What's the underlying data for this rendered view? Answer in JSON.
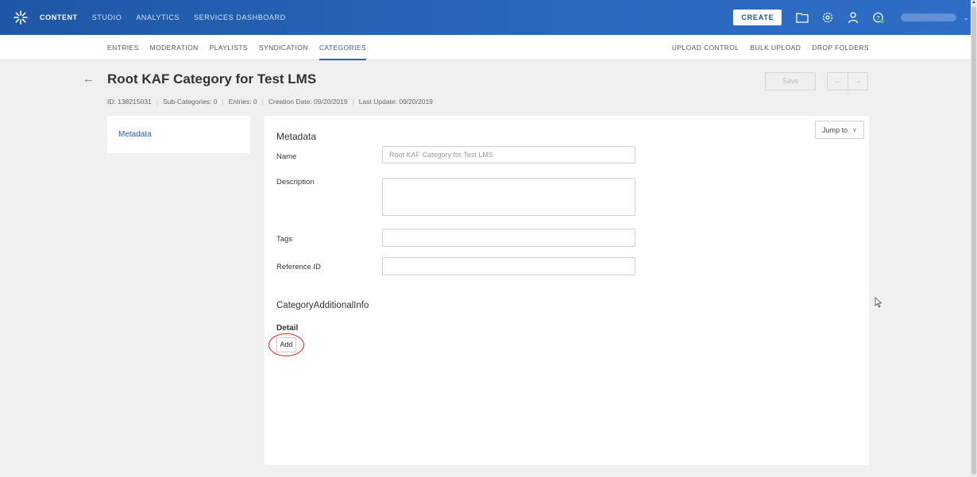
{
  "topnav": {
    "items": [
      "CONTENT",
      "STUDIO",
      "ANALYTICS",
      "SERVICES DASHBOARD"
    ],
    "create_label": "CREATE"
  },
  "subnav": {
    "left": [
      "ENTRIES",
      "MODERATION",
      "PLAYLISTS",
      "SYNDICATION",
      "CATEGORIES"
    ],
    "right": [
      "UPLOAD CONTROL",
      "BULK UPLOAD",
      "DROP FOLDERS"
    ],
    "active": "CATEGORIES"
  },
  "header": {
    "back_icon": "arrow-left-icon",
    "title": "Root KAF Category for Test LMS",
    "meta": {
      "id": "ID: 138215031",
      "subcategories": "Sub-Categories: 0",
      "entries": "Entries: 0",
      "created": "Creation Date: 09/20/2019",
      "updated": "Last Update: 09/20/2019"
    },
    "save_label": "Save",
    "prev_icon": "←",
    "next_icon": "→"
  },
  "sidebar": {
    "items": [
      {
        "label": "Metadata"
      }
    ]
  },
  "main": {
    "jump_label": "Jump to",
    "section_title": "Metadata",
    "fields": {
      "name": {
        "label": "Name",
        "value": "Root KAF Category for Test LMS"
      },
      "description": {
        "label": "Description",
        "value": ""
      },
      "tags": {
        "label": "Tags",
        "value": ""
      },
      "reference_id": {
        "label": "Reference ID",
        "value": ""
      }
    },
    "additional_title": "CategoryAdditionalInfo",
    "detail_label": "Detail",
    "add_label": "Add"
  },
  "colors": {
    "topbar": "#2a68c0",
    "accent": "#2a66b8",
    "highlight_circle": "#e02020"
  }
}
